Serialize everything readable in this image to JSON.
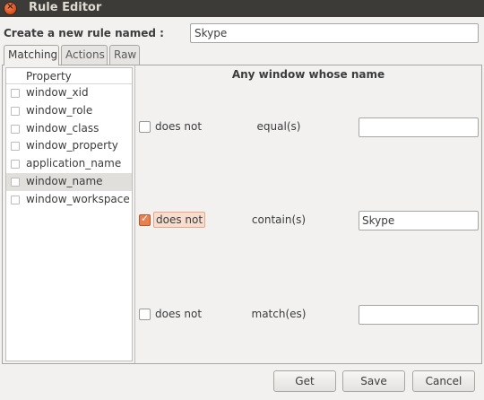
{
  "window": {
    "title": "Rule Editor",
    "close_glyph": "×"
  },
  "rule_name": {
    "label": "Create a new rule named :",
    "value": "Skype"
  },
  "tabs": [
    {
      "label": "Matching"
    },
    {
      "label": "Actions"
    },
    {
      "label": "Raw"
    }
  ],
  "properties": {
    "header": "Property",
    "items": [
      {
        "label": "window_xid",
        "checked": false
      },
      {
        "label": "window_role",
        "checked": false
      },
      {
        "label": "window_class",
        "checked": false
      },
      {
        "label": "window_property",
        "checked": false
      },
      {
        "label": "application_name",
        "checked": false
      },
      {
        "label": "window_name",
        "checked": false,
        "selected": true
      },
      {
        "label": "window_workspace",
        "checked": false
      }
    ]
  },
  "rules": {
    "header": "Any window whose name",
    "rows": [
      {
        "negate_label": "does not",
        "negate_checked": false,
        "operator": "equal(s)",
        "value": ""
      },
      {
        "negate_label": "does not",
        "negate_checked": true,
        "operator": "contain(s)",
        "value": "Skype"
      },
      {
        "negate_label": "does not",
        "negate_checked": false,
        "operator": "match(es)",
        "value": ""
      }
    ]
  },
  "buttons": {
    "get": "Get",
    "save": "Save",
    "cancel": "Cancel"
  },
  "colors": {
    "titlebar": "#3c3b37",
    "accent": "#e0531f",
    "checkbox_checked": "#e8804f"
  }
}
